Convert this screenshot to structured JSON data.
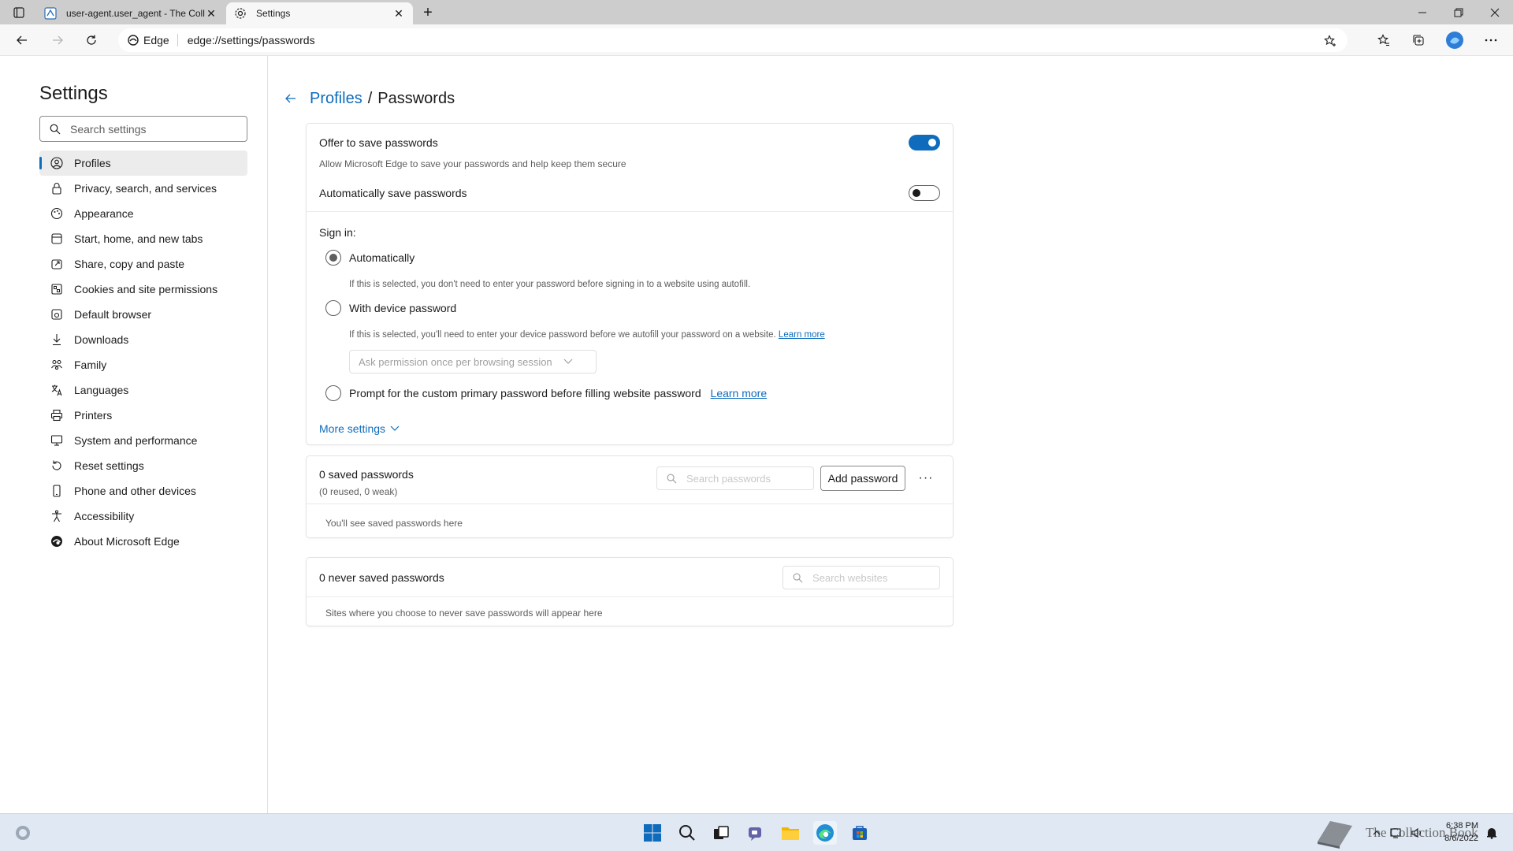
{
  "browser": {
    "tabs": [
      {
        "title": "user-agent.user_agent - The Coll",
        "active": false
      },
      {
        "title": "Settings",
        "active": true
      }
    ],
    "address": {
      "badge": "Edge",
      "url": "edge://settings/passwords"
    }
  },
  "sidebar": {
    "title": "Settings",
    "search_placeholder": "Search settings",
    "items": [
      {
        "label": "Profiles",
        "icon": "profile-icon"
      },
      {
        "label": "Privacy, search, and services",
        "icon": "lock-icon"
      },
      {
        "label": "Appearance",
        "icon": "appearance-icon"
      },
      {
        "label": "Start, home, and new tabs",
        "icon": "home-icon"
      },
      {
        "label": "Share, copy and paste",
        "icon": "share-icon"
      },
      {
        "label": "Cookies and site permissions",
        "icon": "cookies-icon"
      },
      {
        "label": "Default browser",
        "icon": "browser-icon"
      },
      {
        "label": "Downloads",
        "icon": "download-icon"
      },
      {
        "label": "Family",
        "icon": "family-icon"
      },
      {
        "label": "Languages",
        "icon": "languages-icon"
      },
      {
        "label": "Printers",
        "icon": "printer-icon"
      },
      {
        "label": "System and performance",
        "icon": "system-icon"
      },
      {
        "label": "Reset settings",
        "icon": "reset-icon"
      },
      {
        "label": "Phone and other devices",
        "icon": "phone-icon"
      },
      {
        "label": "Accessibility",
        "icon": "accessibility-icon"
      },
      {
        "label": "About Microsoft Edge",
        "icon": "edge-icon"
      }
    ]
  },
  "main": {
    "breadcrumb": {
      "parent": "Profiles",
      "separator": "/",
      "current": "Passwords"
    },
    "offer_save": {
      "label": "Offer to save passwords",
      "description": "Allow Microsoft Edge to save your passwords and help keep them secure",
      "enabled": true
    },
    "auto_save": {
      "label": "Automatically save passwords",
      "enabled": false
    },
    "signin": {
      "heading": "Sign in:",
      "options": [
        {
          "label": "Automatically",
          "description": "If this is selected, you don't need to enter your password before signing in to a website using autofill.",
          "checked": true
        },
        {
          "label": "With device password",
          "description": "If this is selected, you'll need to enter your device password before we autofill your password on a website.",
          "link": "Learn more",
          "checked": false
        },
        {
          "label": "Prompt for the custom primary password before filling website password",
          "link": "Learn more",
          "checked": false
        }
      ],
      "dropdown_value": "Ask permission once per browsing session"
    },
    "more_settings": "More settings",
    "saved": {
      "title": "0 saved passwords",
      "subtitle": "(0 reused, 0 weak)",
      "search_placeholder": "Search passwords",
      "add_button": "Add password",
      "more": "···",
      "empty": "You'll see saved passwords here"
    },
    "never_saved": {
      "title": "0 never saved passwords",
      "search_placeholder": "Search websites",
      "empty": "Sites where you choose to never save passwords will appear here"
    }
  },
  "taskbar": {
    "time": "6:38 PM",
    "date": "8/6/2022",
    "watermark": "The Collection Book"
  },
  "colors": {
    "accent": "#0f6cbd",
    "taskbar": "#dfe8f3",
    "tabstrip": "#cdcdcd"
  }
}
